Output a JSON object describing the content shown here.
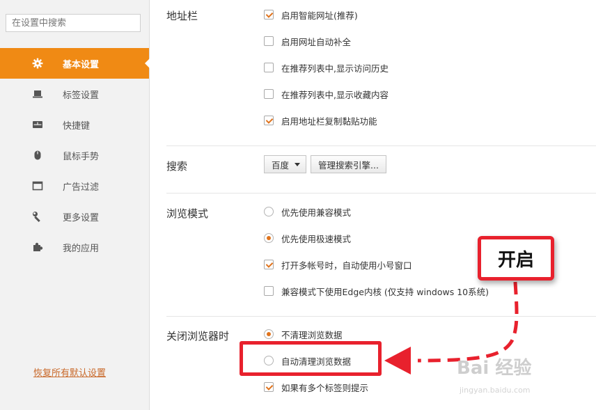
{
  "sidebar": {
    "search_placeholder": "在设置中搜索",
    "items": [
      {
        "label": "基本设置",
        "icon": "gear-icon",
        "active": true
      },
      {
        "label": "标签设置",
        "icon": "laptop-icon"
      },
      {
        "label": "快捷键",
        "icon": "keyboard-icon"
      },
      {
        "label": "鼠标手势",
        "icon": "mouse-icon"
      },
      {
        "label": "广告过滤",
        "icon": "window-icon"
      },
      {
        "label": "更多设置",
        "icon": "wrench-icon"
      },
      {
        "label": "我的应用",
        "icon": "puzzle-icon"
      }
    ],
    "restore_link": "恢复所有默认设置"
  },
  "sections": {
    "address_bar": {
      "title": "地址栏",
      "options": [
        {
          "label": "启用智能网址(推荐)",
          "checked": true
        },
        {
          "label": "启用网址自动补全",
          "checked": false
        },
        {
          "label": "在推荐列表中,显示访问历史",
          "checked": false
        },
        {
          "label": "在推荐列表中,显示收藏内容",
          "checked": false
        },
        {
          "label": "启用地址栏复制黏贴功能",
          "checked": true
        }
      ]
    },
    "search": {
      "title": "搜索",
      "engine_selected": "百度",
      "manage_button": "管理搜索引擎..."
    },
    "browse_mode": {
      "title": "浏览模式",
      "radios": [
        {
          "label": "优先使用兼容模式",
          "selected": false
        },
        {
          "label": "优先使用极速模式",
          "selected": true
        }
      ],
      "checkboxes": [
        {
          "label": "打开多帐号时，自动使用小号窗口",
          "checked": true
        },
        {
          "label": "兼容模式下使用Edge内核 (仅支持 windows 10系统)",
          "checked": false
        }
      ]
    },
    "on_close": {
      "title": "关闭浏览器时",
      "radios": [
        {
          "label": "不清理浏览数据",
          "selected": true
        },
        {
          "label": "自动清理浏览数据",
          "selected": false
        }
      ],
      "checkboxes": [
        {
          "label": "如果有多个标签则提示",
          "checked": true
        }
      ]
    }
  },
  "annotation": {
    "callout_text": "开启",
    "color": "#e8212d"
  },
  "watermark": {
    "text": "Bai 经验",
    "sub": "jingyan.baidu.com"
  },
  "colors": {
    "accent": "#f08a14",
    "check": "#e0731c"
  }
}
